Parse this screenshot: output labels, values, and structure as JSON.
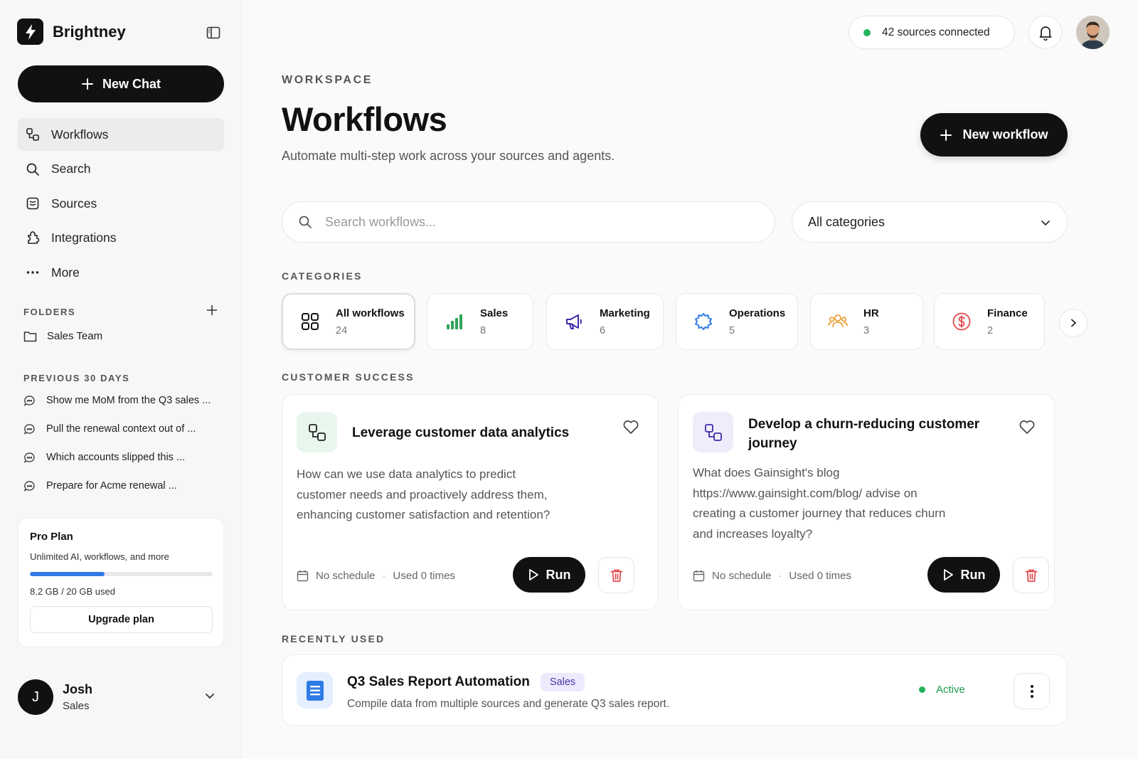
{
  "brand": {
    "name": "Brightney"
  },
  "sidebar": {
    "new_chat_label": "New Chat",
    "nav": [
      {
        "label": "Workflows",
        "icon": "workflow-icon",
        "active": true
      },
      {
        "label": "Search",
        "icon": "search-icon"
      },
      {
        "label": "Sources",
        "icon": "database-icon"
      },
      {
        "label": "Integrations",
        "icon": "puzzle-icon"
      },
      {
        "label": "More",
        "icon": "more-icon"
      }
    ],
    "folders_label": "FOLDERS",
    "folders": [
      {
        "label": "Sales Team"
      }
    ],
    "history_label": "PREVIOUS 30 DAYS",
    "history": [
      {
        "label": "Show me MoM from the Q3 sales ..."
      },
      {
        "label": "Pull the renewal context out of ..."
      },
      {
        "label": "Which accounts slipped this ..."
      },
      {
        "label": "Prepare for Acme renewal ..."
      }
    ],
    "plan": {
      "title": "Pro Plan",
      "subtitle": "Unlimited AI, workflows, and more",
      "usage_fraction": 0.41,
      "used_label": "8.2 GB / 20 GB used",
      "upgrade_label": "Upgrade plan"
    },
    "user": {
      "initial": "J",
      "name": "Josh",
      "role": "Sales"
    }
  },
  "topbar": {
    "sources_label": "42 sources connected"
  },
  "header": {
    "eyebrow": "WORKSPACE",
    "title": "Workflows",
    "subtitle": "Automate multi-step work across your sources and agents.",
    "new_workflow_label": "New workflow"
  },
  "filters": {
    "search_placeholder": "Search workflows...",
    "category_selected": "All categories"
  },
  "categories_label": "CATEGORIES",
  "categories": [
    {
      "name": "All workflows",
      "count": "24",
      "icon": "grid-icon",
      "active": true
    },
    {
      "name": "Sales",
      "count": "8",
      "icon": "bar-chart-icon"
    },
    {
      "name": "Marketing",
      "count": "6",
      "icon": "megaphone-icon"
    },
    {
      "name": "Operations",
      "count": "5",
      "icon": "gear-icon"
    },
    {
      "name": "HR",
      "count": "3",
      "icon": "people-icon"
    },
    {
      "name": "Finance",
      "count": "2",
      "icon": "dollar-icon"
    }
  ],
  "section_label": "CUSTOMER SUCCESS",
  "workflows": [
    {
      "title": "Leverage customer data analytics",
      "description": "How can we use data analytics to predict customer needs and proactively address them, enhancing customer satisfaction and retention?",
      "schedule": "No schedule",
      "usage": "Used 0 times",
      "run_label": "Run",
      "icon_bg": "#e9f6ee"
    },
    {
      "title": "Develop a churn-reducing customer journey",
      "description": "What does Gainsight's blog https://www.gainsight.com/blog/ advise on creating a customer journey that reduces churn and increases loyalty?",
      "schedule": "No schedule",
      "usage": "Used 0 times",
      "run_label": "Run",
      "icon_bg": "#efedfb"
    }
  ],
  "recent_label": "RECENTLY USED",
  "recent": {
    "title": "Q3 Sales Report Automation",
    "tag": "Sales",
    "description": "Compile data from multiple sources and generate Q3 sales report.",
    "status": "Active"
  },
  "colors": {
    "accent": "#111111",
    "success": "#22b35a",
    "danger": "#e5484d",
    "progress": "#2f7be6"
  }
}
